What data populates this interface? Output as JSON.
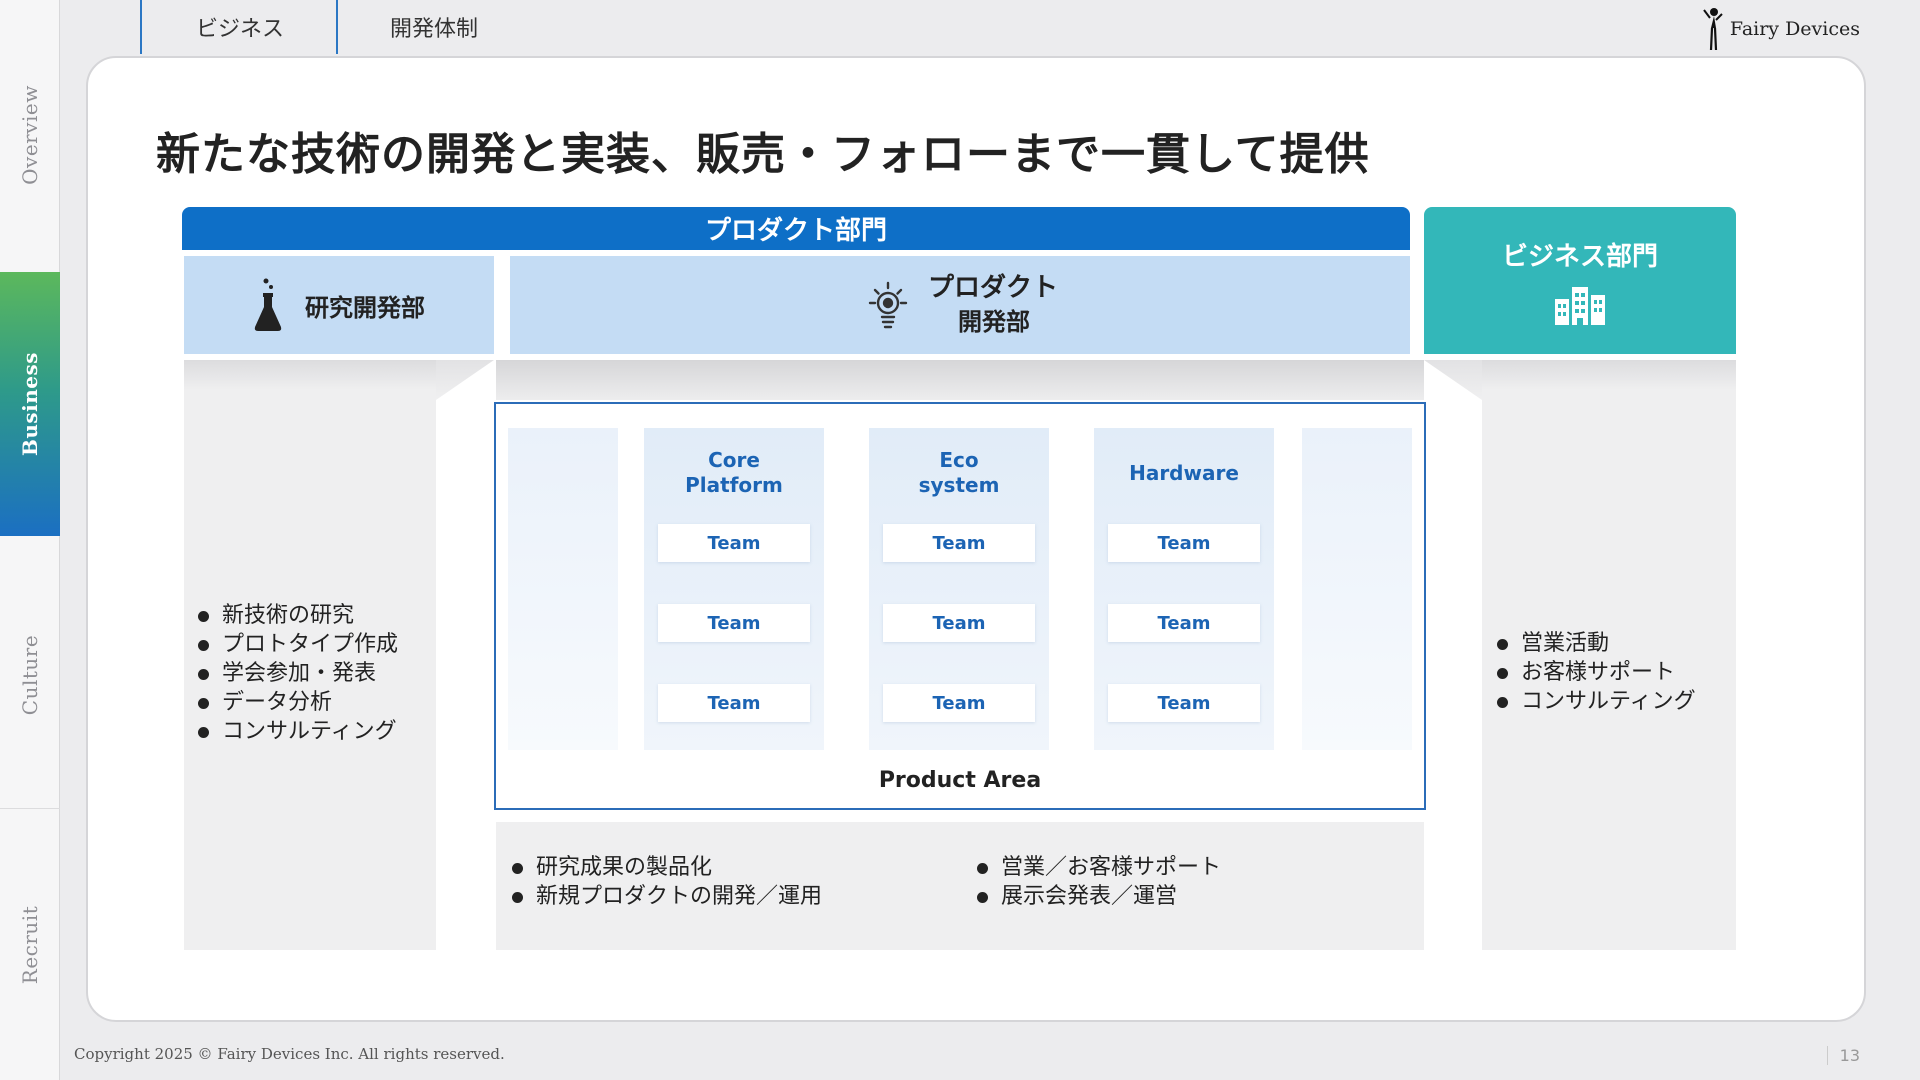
{
  "sidenav": {
    "items": [
      {
        "label": "Overview"
      },
      {
        "label": "Business"
      },
      {
        "label": "Culture"
      },
      {
        "label": "Recruit"
      }
    ]
  },
  "tabs": [
    {
      "label": "ビジネス"
    },
    {
      "label": "開発体制"
    }
  ],
  "logo": {
    "text": "Fairy Devices"
  },
  "slide": {
    "title": "新たな技術の開発と実装、販売・フォローまで一貫して提供",
    "product_division": "プロダクト部門",
    "rd_dept": "研究開発部",
    "product_dept_line1": "プロダクト",
    "product_dept_line2": "開発部",
    "business_division": "ビジネス部門",
    "product_area_label": "Product Area",
    "columns": [
      {
        "head": "Core\nPlatform",
        "teams": [
          "Team",
          "Team",
          "Team"
        ]
      },
      {
        "head": "Eco\nsystem",
        "teams": [
          "Team",
          "Team",
          "Team"
        ]
      },
      {
        "head": "Hardware",
        "teams": [
          "Team",
          "Team",
          "Team"
        ]
      }
    ],
    "rd_bullets": [
      "新技術の研究",
      "プロトタイプ作成",
      "学会参加・発表",
      "データ分析",
      "コンサルティング"
    ],
    "biz_bullets": [
      "営業活動",
      "お客様サポート",
      "コンサルティング"
    ],
    "bottom_left_bullets": [
      "研究成果の製品化",
      "新規プロダクトの開発／運用"
    ],
    "bottom_right_bullets": [
      "営業／お客様サポート",
      "展示会発表／運営"
    ]
  },
  "footer": {
    "copyright": "Copyright 2025 © Fairy Devices Inc. All rights reserved.",
    "page": "13"
  },
  "colors": {
    "product_blue": "#0e6fc7",
    "light_blue": "#c4dcf4",
    "business_teal": "#33b7b9",
    "team_text": "#1c64b4"
  }
}
